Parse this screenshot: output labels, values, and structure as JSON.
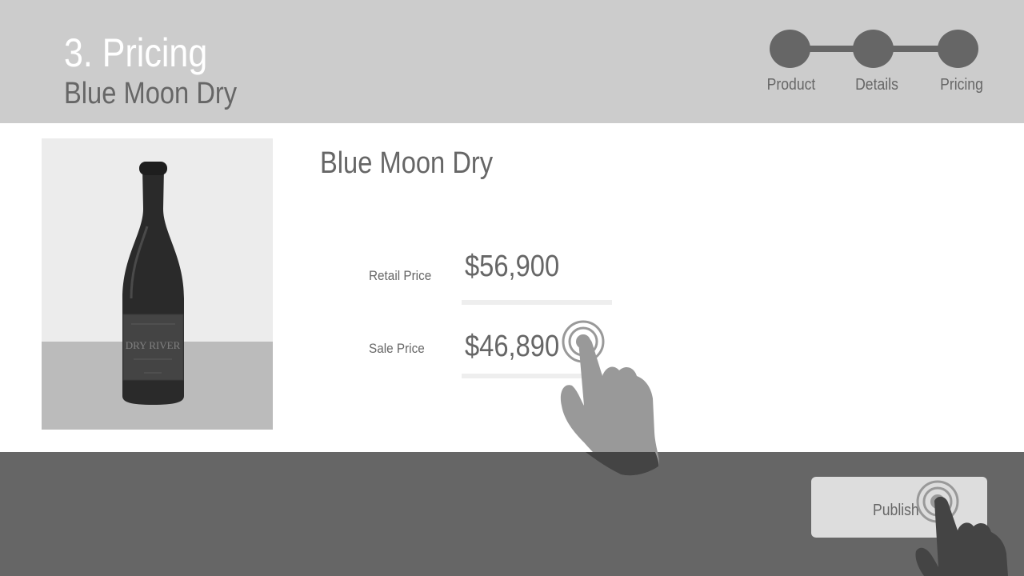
{
  "header": {
    "step_title": "3. Pricing",
    "subtitle": "Blue Moon Dry"
  },
  "stepper": {
    "steps": [
      {
        "label": "Product"
      },
      {
        "label": "Details"
      },
      {
        "label": "Pricing"
      }
    ]
  },
  "product": {
    "name": "Blue Moon Dry",
    "image_icon": "wine-bottle-photo",
    "bottle_label": "DRY RIVER"
  },
  "pricing": {
    "retail_label": "Retail Price",
    "retail_value": "$56,900",
    "sale_label": "Sale Price",
    "sale_value": "$46,890"
  },
  "footer": {
    "publish_label": "Publish"
  },
  "gestures": {
    "icon": "tap-hand-icon"
  },
  "colors": {
    "header_bg": "#cccccc",
    "footer_bg": "#666666",
    "text": "#666666",
    "button_bg": "#dddddd"
  }
}
